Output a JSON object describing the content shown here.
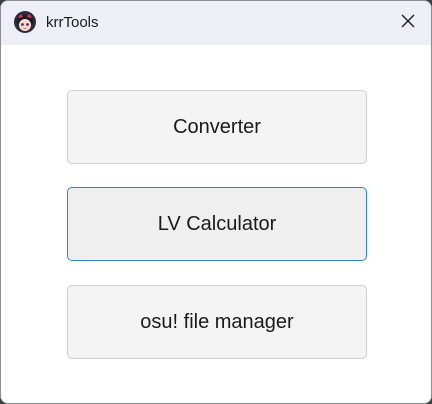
{
  "window": {
    "title": "krrTools",
    "app_icon": "anime-avatar-icon",
    "close_icon": "close-icon"
  },
  "buttons": {
    "converter": "Converter",
    "lv_calculator": "LV Calculator",
    "osu_file_manager": "osu! file manager"
  },
  "colors": {
    "titlebar_bg": "#eeeef6",
    "focus_border": "#2f86d8",
    "button_bg": "#f4f4f4"
  }
}
